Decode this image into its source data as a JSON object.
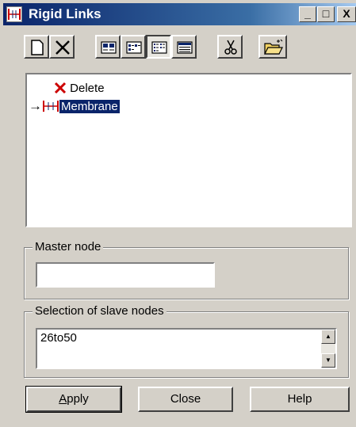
{
  "window": {
    "title": "Rigid Links",
    "minimize_glyph": "_",
    "maximize_glyph": "□",
    "close_glyph": "X"
  },
  "toolbar": {
    "buttons": [
      {
        "name": "new-icon"
      },
      {
        "name": "delete-icon"
      },
      {
        "name": "view-large-icons-icon"
      },
      {
        "name": "view-small-icons-icon"
      },
      {
        "name": "view-list-icon"
      },
      {
        "name": "view-details-icon"
      },
      {
        "name": "cut-icon"
      },
      {
        "name": "open-folder-icon"
      }
    ],
    "pressed_button": "view-list-icon"
  },
  "tree": {
    "items": [
      {
        "label": "Delete",
        "icon": "red-x-icon"
      },
      {
        "label": "Membrane",
        "icon": "rigid-link-icon",
        "selected": true,
        "current_marker": "→"
      }
    ]
  },
  "master_node": {
    "legend": "Master node",
    "value": ""
  },
  "slave_nodes": {
    "legend": "Selection of slave nodes",
    "value": "26to50"
  },
  "buttons": {
    "apply": "Apply",
    "close": "Close",
    "help": "Help"
  },
  "colors": {
    "title_bar": "#0a246a",
    "face": "#d4d0c8",
    "selection": "#0a246a",
    "delete_x": "#cc0000"
  }
}
